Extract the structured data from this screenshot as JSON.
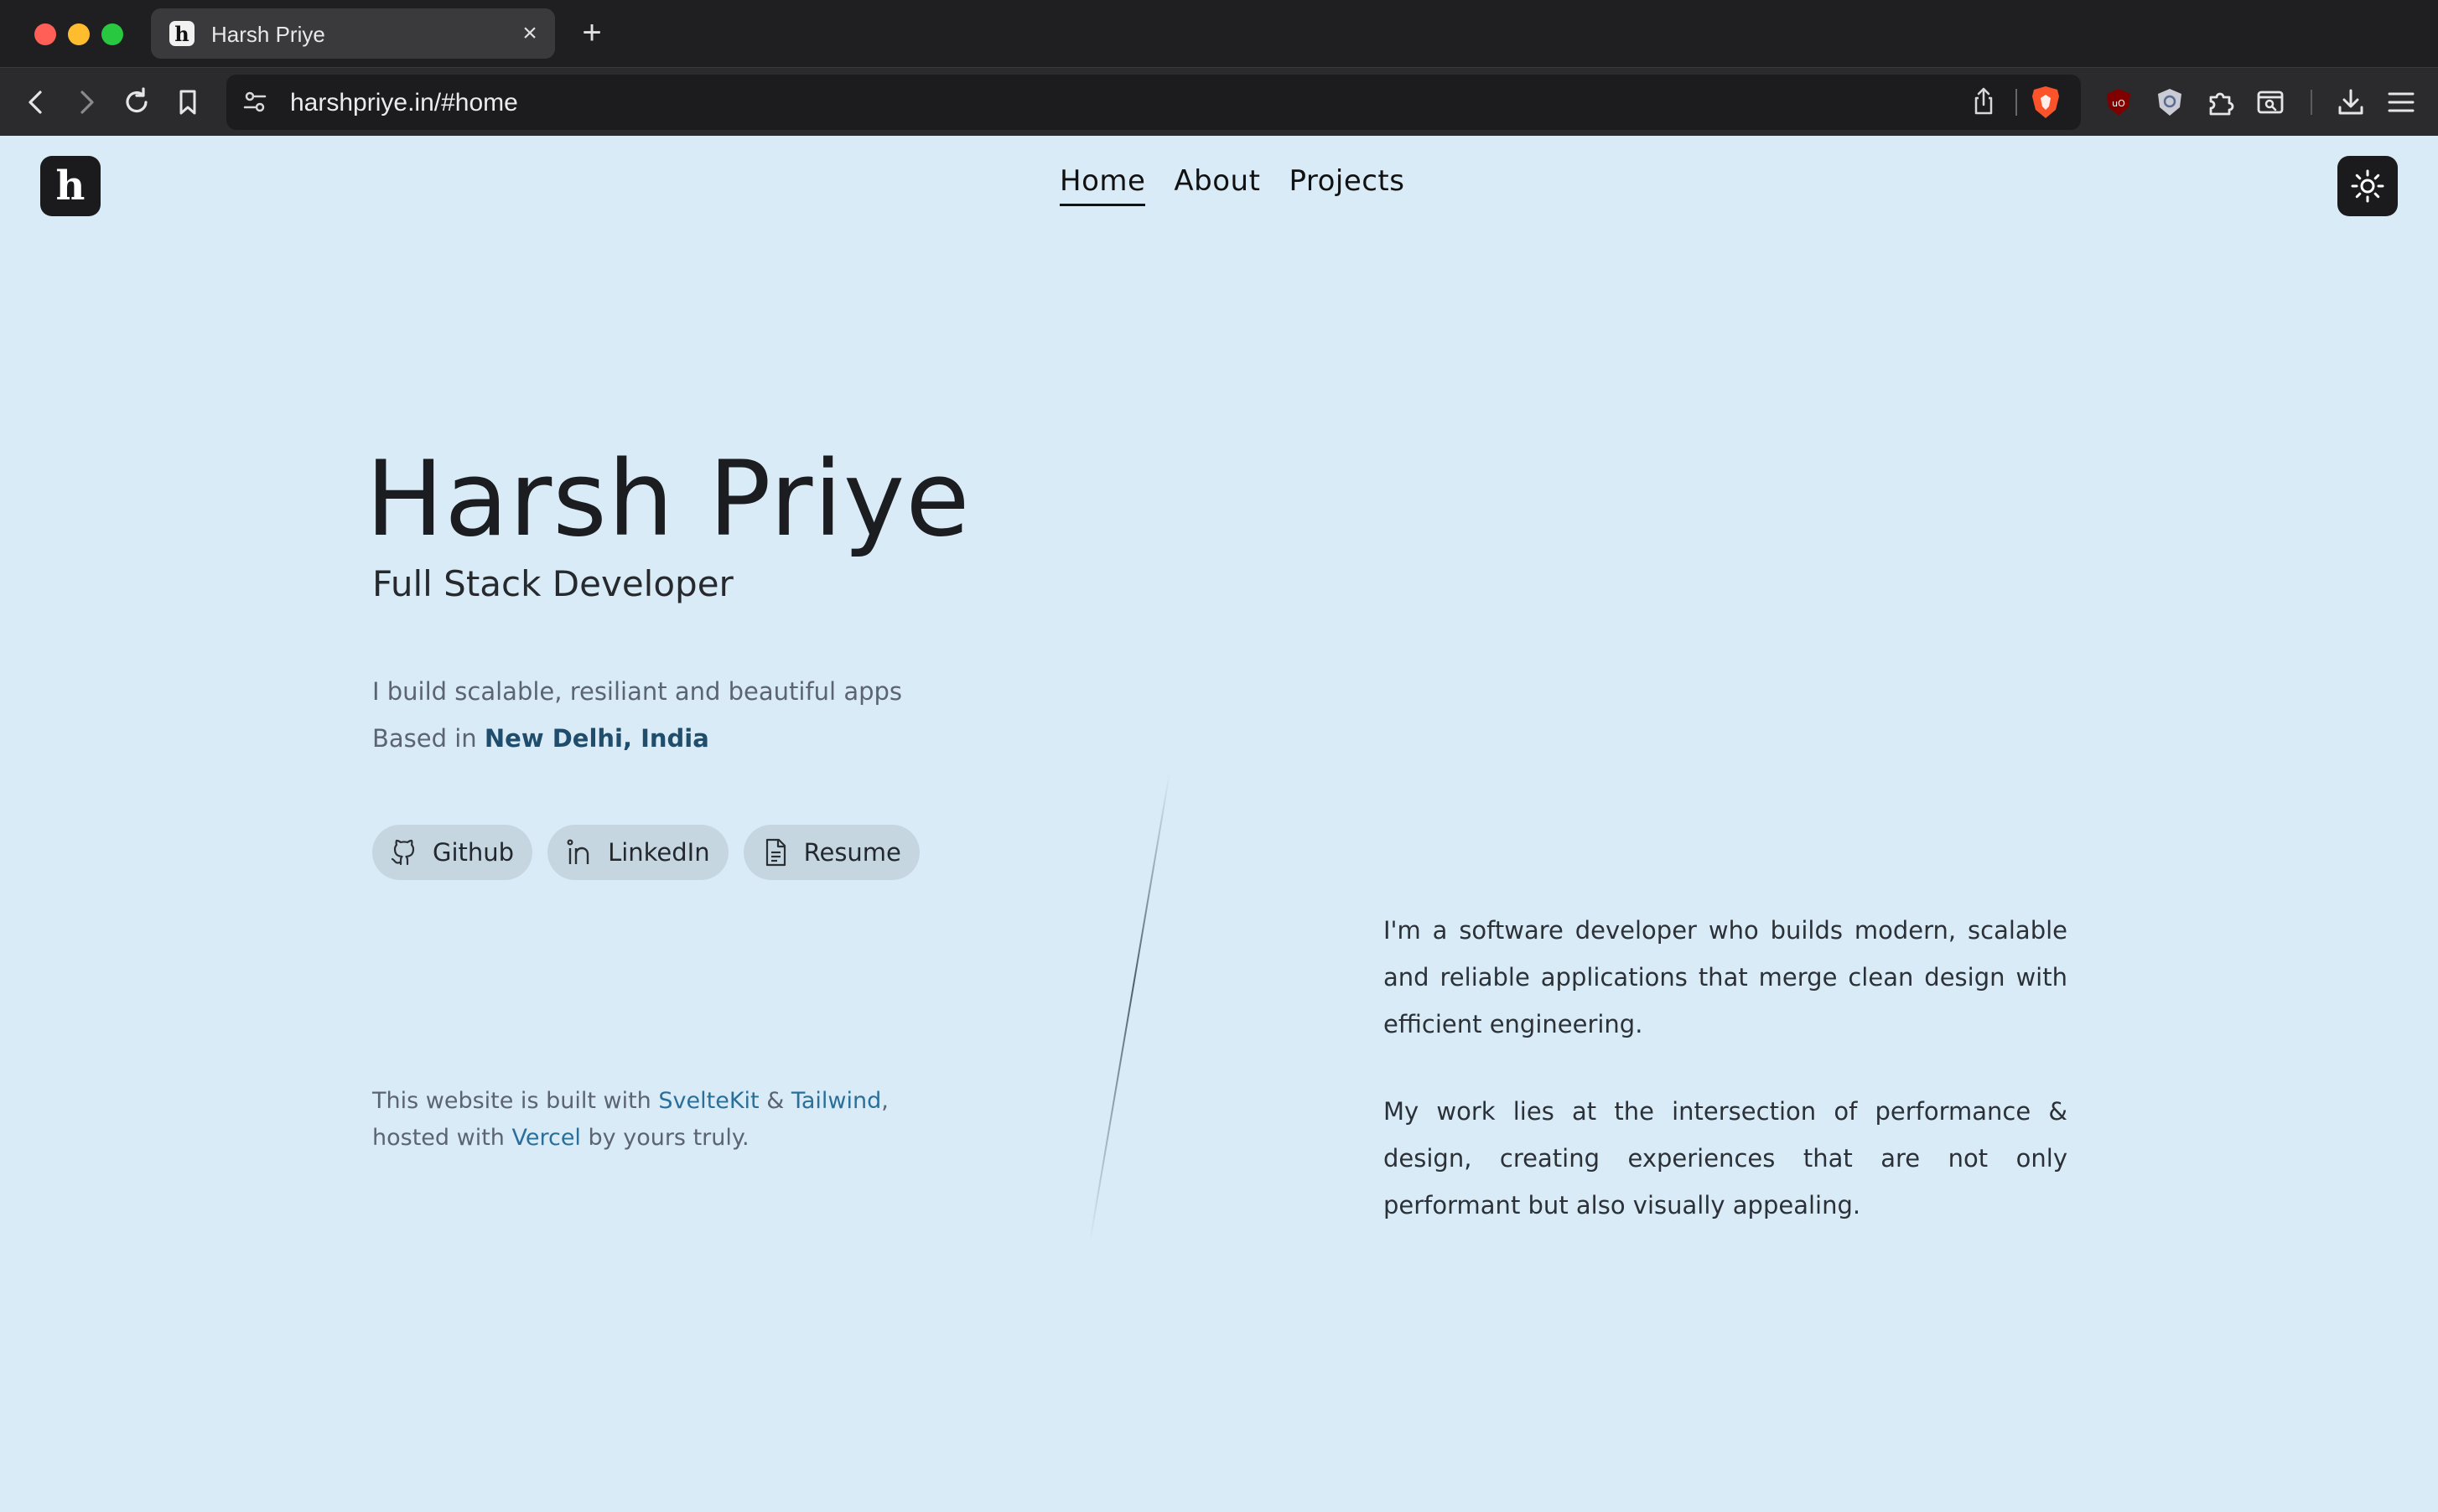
{
  "browser": {
    "tab_title": "Harsh Priye",
    "tab_favicon_letter": "h",
    "new_tab_label": "+",
    "close_label": "×",
    "url": "harshpriye.in/#home"
  },
  "site": {
    "logo_letter": "h",
    "nav": [
      {
        "label": "Home",
        "active": true
      },
      {
        "label": "About",
        "active": false
      },
      {
        "label": "Projects",
        "active": false
      }
    ],
    "theme_toggle_icon": "sun-icon"
  },
  "hero": {
    "name": "Harsh Priye",
    "role": "Full Stack Developer",
    "tagline": "I build scalable, resiliant and beautiful apps",
    "location_prefix": "Based in ",
    "location": "New Delhi, India",
    "links": [
      {
        "label": "Github",
        "icon": "github-icon"
      },
      {
        "label": "LinkedIn",
        "icon": "linkedin-icon"
      },
      {
        "label": "Resume",
        "icon": "document-icon"
      }
    ],
    "built_prefix": "This website is built with ",
    "built_tech1": "SvelteKit",
    "built_amp": " & ",
    "built_tech2": "Tailwind",
    "built_comma": ",",
    "built_hosted": "hosted with ",
    "built_host": "Vercel",
    "built_suffix": " by yours truly."
  },
  "about": {
    "paragraph1": "I'm a software developer who builds modern, scalable and reliable applications that merge clean design with efficient engineering.",
    "paragraph2": "My work lies at the intersection of performance & design, creating experiences that are not only performant but also visually appealing."
  },
  "colors": {
    "page_bg": "#d9ebf7",
    "accent_link": "#2a6f99",
    "location": "#1f4d6b",
    "dark_button": "#1b1b1d"
  }
}
